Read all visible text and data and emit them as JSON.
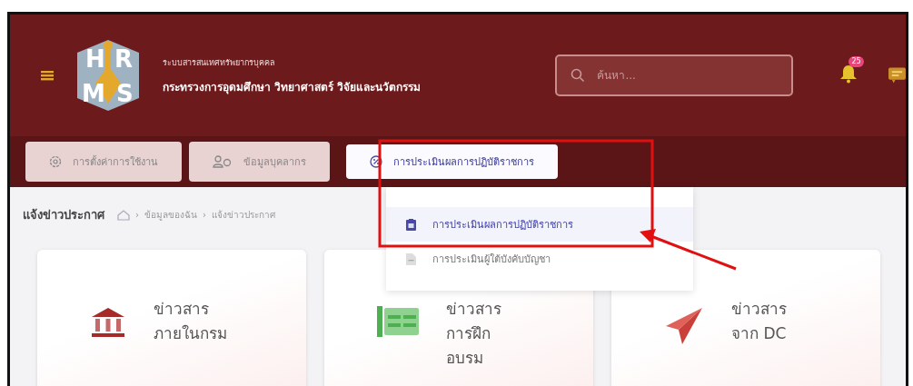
{
  "header": {
    "logo": {
      "letters": [
        "H",
        "R",
        "M",
        "S"
      ]
    },
    "subtitle": "ระบบสารสนเทศทรัพยากรบุคคล",
    "title": "กระทรวงการอุดมศึกษา วิทยาศาสตร์ วิจัยและนวัตกรรม",
    "search": {
      "placeholder": "ค้นหา..."
    },
    "notification_badge": "25"
  },
  "nav": [
    {
      "label": "การตั้งค่าการใช้งาน",
      "kind": "settings",
      "selected": false
    },
    {
      "label": "ข้อมูลบุคลากร",
      "kind": "people",
      "selected": false
    },
    {
      "label": "การประเมินผลการปฏิบัติราชการ",
      "kind": "evaluation",
      "selected": true
    }
  ],
  "dropdown": [
    {
      "label": "การประเมินผลการปฏิบัติราชการ",
      "selected": true
    },
    {
      "label": "การประเมินผู้ใต้บังคับบัญชา",
      "selected": false
    }
  ],
  "page_title": "แจ้งข่าวประกาศ",
  "breadcrumb": [
    "ข้อมูลของฉัน",
    "แจ้งข่าวประกาศ"
  ],
  "breadcrumb_separator": "›",
  "cards": [
    {
      "kind": "building",
      "lines": [
        "ข่าวสาร",
        "ภายในกรม"
      ]
    },
    {
      "kind": "training",
      "lines": [
        "ข่าวสาร",
        "การฝึก",
        "อบรม"
      ]
    },
    {
      "kind": "plane",
      "lines": [
        "ข่าวสาร",
        "จาก DC"
      ]
    }
  ]
}
